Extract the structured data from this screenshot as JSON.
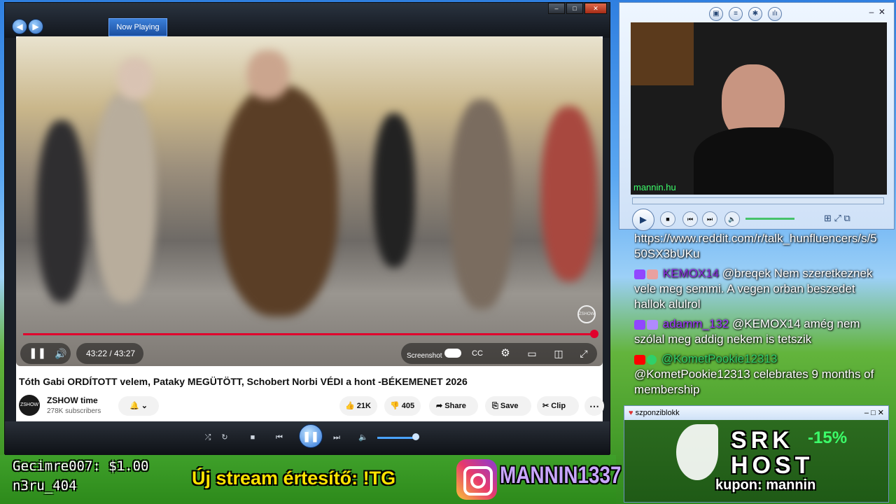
{
  "wmp": {
    "tab_label": "Now Playing",
    "window_buttons": [
      "–",
      "□",
      "✕"
    ]
  },
  "video": {
    "time": "43:22 / 43:27",
    "screenshot_label": "Screenshot",
    "watermark": "ZSHOW",
    "progress_fraction": 0.998
  },
  "yt": {
    "title": "Tóth Gabi ORDÍTOTT velem, Pataky MEGÜTÖTT, Schobert Norbi VÉDI a hont -BÉKEMENET 2026",
    "channel_avatar": "ZSHOW time",
    "channel_name": "ZSHOW time",
    "subscribers": "278K subscribers",
    "like_count": "21K",
    "dislike_count": "405",
    "share_label": "Share",
    "save_label": "Save",
    "clip_label": "Clip",
    "more_label": "⋯"
  },
  "cam": {
    "url": "mannin.hu"
  },
  "chat": {
    "partial_line": "https://www.reddit.com/r/talk_hunfluencers/s/550SX3bUKu",
    "messages": [
      {
        "user": "KEMOX14",
        "user_color": "#8a2be2",
        "text": "@breqek Nem szeretkeznek vele meg semmi. A vegen orban beszedet hallok alulrol"
      },
      {
        "user": "adamm_132",
        "user_color": "#a033ff",
        "text": "@KEMOX14 amég nem szólal meg addig nekem is tetszik"
      },
      {
        "user": "@KometPookie12313",
        "user_color": "#2fd06a",
        "text": "@KometPookie12313 celebrates 9 months of membership"
      }
    ]
  },
  "sponsor": {
    "window_title": "szponziblokk",
    "brand_line1": "SRK",
    "brand_line2": "HOST",
    "discount": "-15%",
    "coupon": "kupon: mannin"
  },
  "overlay": {
    "donation": "Gecimre007: $1.00",
    "user2": "n3ru_404",
    "notify": "Új stream értesítő: !TG",
    "instagram": "MANNIN1337"
  }
}
